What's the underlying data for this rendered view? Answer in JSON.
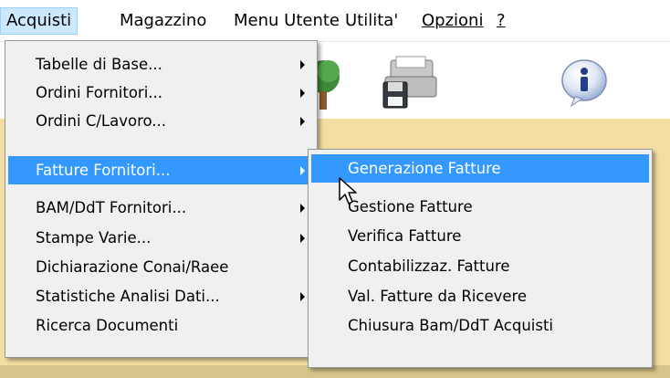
{
  "menubar": {
    "items": [
      {
        "label": "Acquisti",
        "name": "menubar-acquisti"
      },
      {
        "label": "Magazzino",
        "name": "menubar-magazzino"
      },
      {
        "label": "Menu Utente",
        "name": "menubar-menu-utente"
      },
      {
        "label": "Utilita'",
        "name": "menubar-utilita"
      },
      {
        "label": "Opzioni",
        "name": "menubar-opzioni"
      },
      {
        "label": "?",
        "name": "menubar-help"
      }
    ]
  },
  "toolbar": {
    "icons": [
      "tree-icon",
      "floppy-disk-icon",
      "printer-icon",
      "info-icon"
    ]
  },
  "acquisti_menu": {
    "items": [
      {
        "label": "Tabelle di Base...",
        "has_submenu": true
      },
      {
        "label": "Ordini Fornitori...",
        "has_submenu": true
      },
      {
        "label": "Ordini C/Lavoro...",
        "has_submenu": true
      },
      {
        "label": "Fatture Fornitori...",
        "has_submenu": true,
        "selected": true
      },
      {
        "label": "BAM/DdT Fornitori...",
        "has_submenu": true
      },
      {
        "label": "Stampe Varie...",
        "has_submenu": true
      },
      {
        "label": "Dichiarazione Conai/Raee",
        "has_submenu": false
      },
      {
        "label": "Statistiche Analisi Dati...",
        "has_submenu": true
      },
      {
        "label": "Ricerca Documenti",
        "has_submenu": false
      }
    ]
  },
  "fatture_submenu": {
    "items": [
      {
        "label": "Generazione Fatture",
        "selected": true
      },
      {
        "label": "Gestione Fatture"
      },
      {
        "label": "Verifica Fatture"
      },
      {
        "label": "Contabilizzaz. Fatture"
      },
      {
        "label": "Val. Fatture da Ricevere"
      },
      {
        "label": "Chiusura Bam/DdT Acquisti"
      }
    ]
  },
  "colors": {
    "highlight": "#3399ff",
    "menu_bg": "#f0f0f0",
    "content_bg": "#f3dfa1"
  }
}
